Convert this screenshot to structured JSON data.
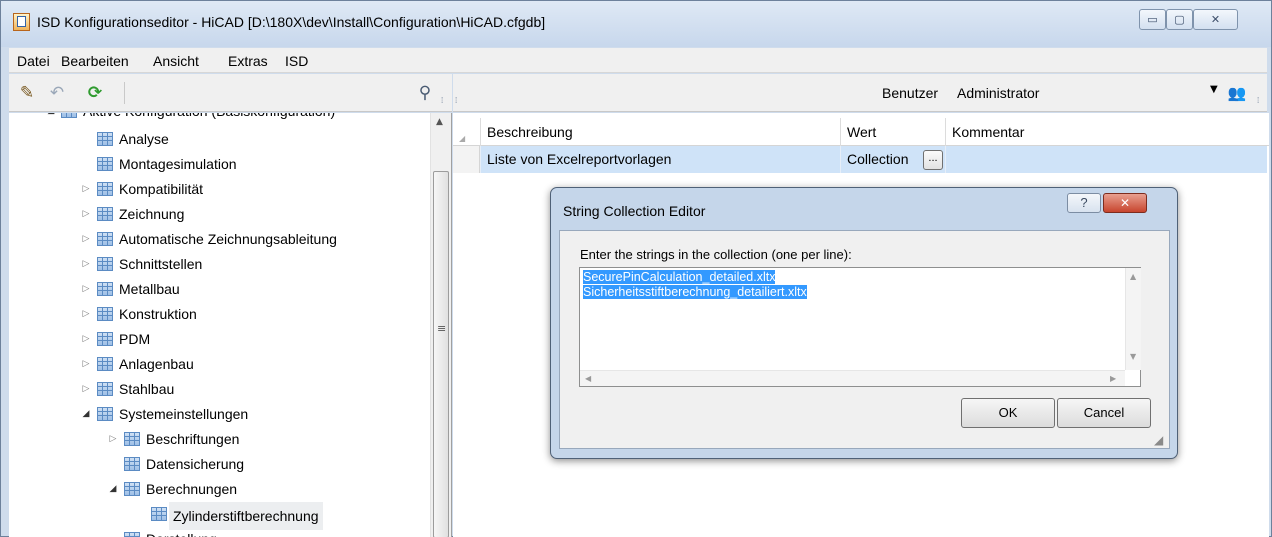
{
  "window": {
    "title": "ISD Konfigurationseditor  - HiCAD [D:\\180X\\dev\\Install\\Configuration\\HiCAD.cfgdb]",
    "controls": {
      "minimize": "▭",
      "maximize": "▢",
      "close": "✕"
    }
  },
  "menu": [
    "Datei",
    "Bearbeiten",
    "Ansicht",
    "Extras",
    "ISD"
  ],
  "toolbar": {
    "edit_icon": "pencil-icon",
    "back_icon": "undo-icon",
    "refresh_icon": "refresh-icon",
    "search_icon": "binoculars-icon",
    "user_label": "Benutzer",
    "user_value": "Administrator",
    "users_icon": "users-icon",
    "pencil_glyph": "✎",
    "back_glyph": "↶",
    "refresh_glyph": "⟳",
    "search_glyph": "⚲",
    "dropdown_glyph": "▼",
    "users_glyph": "👥",
    "grip_glyph": "⁞"
  },
  "tree": {
    "root_label": "Aktive Konfiguration (Basiskonfiguration)",
    "items": [
      {
        "label": "Analyse",
        "expander": ""
      },
      {
        "label": "Montagesimulation",
        "expander": ""
      },
      {
        "label": "Kompatibilität",
        "expander": "▷"
      },
      {
        "label": "Zeichnung",
        "expander": "▷"
      },
      {
        "label": "Automatische Zeichnungsableitung",
        "expander": "▷"
      },
      {
        "label": "Schnittstellen",
        "expander": "▷"
      },
      {
        "label": "Metallbau",
        "expander": "▷"
      },
      {
        "label": "Konstruktion",
        "expander": "▷"
      },
      {
        "label": "PDM",
        "expander": "▷"
      },
      {
        "label": "Anlagenbau",
        "expander": "▷"
      },
      {
        "label": "Stahlbau",
        "expander": "▷"
      },
      {
        "label": "Systemeinstellungen",
        "expander": "◢"
      },
      {
        "label": "Beschriftungen",
        "expander": "▷"
      },
      {
        "label": "Datensicherung",
        "expander": ""
      },
      {
        "label": "Berechnungen",
        "expander": "◢"
      },
      {
        "label": "Zylinderstiftberechnung",
        "expander": ""
      },
      {
        "label": "Darstellung",
        "expander": ""
      }
    ],
    "root_expander": "◢",
    "scroll_up": "▲",
    "scroll_grip": "≡"
  },
  "grid": {
    "columns": [
      "Beschreibung",
      "Wert",
      "Kommentar"
    ],
    "row": {
      "description": "Liste von Excelreportvorlagen",
      "value": "Collection",
      "button": "...",
      "comment": ""
    },
    "corner_glyph": "◢"
  },
  "dialog": {
    "title": "String Collection Editor",
    "help": "?",
    "close": "✕",
    "instruction": "Enter the strings in the collection (one per line):",
    "lines": [
      "SecurePinCalculation_detailed.xltx",
      "Sicherheitsstiftberechnung_detailiert.xltx"
    ],
    "ok": "OK",
    "cancel": "Cancel",
    "scroll_up": "▲",
    "scroll_down": "▼",
    "scroll_left": "◀",
    "scroll_right": "▶",
    "resize_glyph": "◢"
  }
}
